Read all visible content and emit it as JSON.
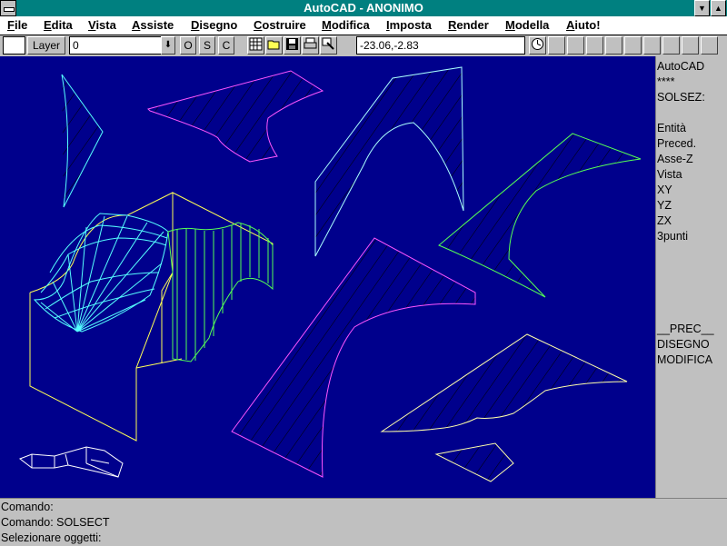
{
  "window": {
    "title": "AutoCAD - ANONIMO"
  },
  "menu": [
    {
      "label": "File",
      "u": "F",
      "rest": "ile"
    },
    {
      "label": "Edita",
      "u": "E",
      "rest": "dita"
    },
    {
      "label": "Vista",
      "u": "V",
      "rest": "ista"
    },
    {
      "label": "Assiste",
      "u": "A",
      "rest": "ssiste"
    },
    {
      "label": "Disegno",
      "u": "D",
      "rest": "isegno"
    },
    {
      "label": "Costruire",
      "u": "C",
      "rest": "ostruire"
    },
    {
      "label": "Modifica",
      "u": "M",
      "rest": "odifica"
    },
    {
      "label": "Imposta",
      "u": "I",
      "rest": "mposta"
    },
    {
      "label": "Render",
      "u": "R",
      "rest": "ender"
    },
    {
      "label": "Modella",
      "u": "M",
      "rest": "odella"
    },
    {
      "label": "Aiuto!",
      "u": "A",
      "rest": "iuto!"
    }
  ],
  "toolbar": {
    "layer_button": "Layer",
    "layer_value": "0",
    "ortho": "O",
    "snap": "S",
    "coords_toggle": "C",
    "coordinates": "-23.06,-2.83"
  },
  "side_menu": {
    "header": "AutoCAD",
    "stars": "****",
    "command": "SOLSEZ:",
    "options": [
      "Entità",
      "Preced.",
      "Asse-Z",
      "Vista",
      "XY",
      "YZ",
      "ZX",
      "3punti"
    ],
    "prev": "__PREC__",
    "disegno": "DISEGNO",
    "modifica": "MODIFICA"
  },
  "command_lines": [
    "Comando:",
    "Comando: SOLSECT",
    "Selezionare oggetti:"
  ],
  "colors": {
    "drawing_background": "#00008c",
    "title_bar": "#008080",
    "cyan": "#55ffff",
    "yellow": "#ffff55",
    "green": "#55ff55",
    "magenta": "#ff55ff",
    "white": "#ffffff"
  }
}
